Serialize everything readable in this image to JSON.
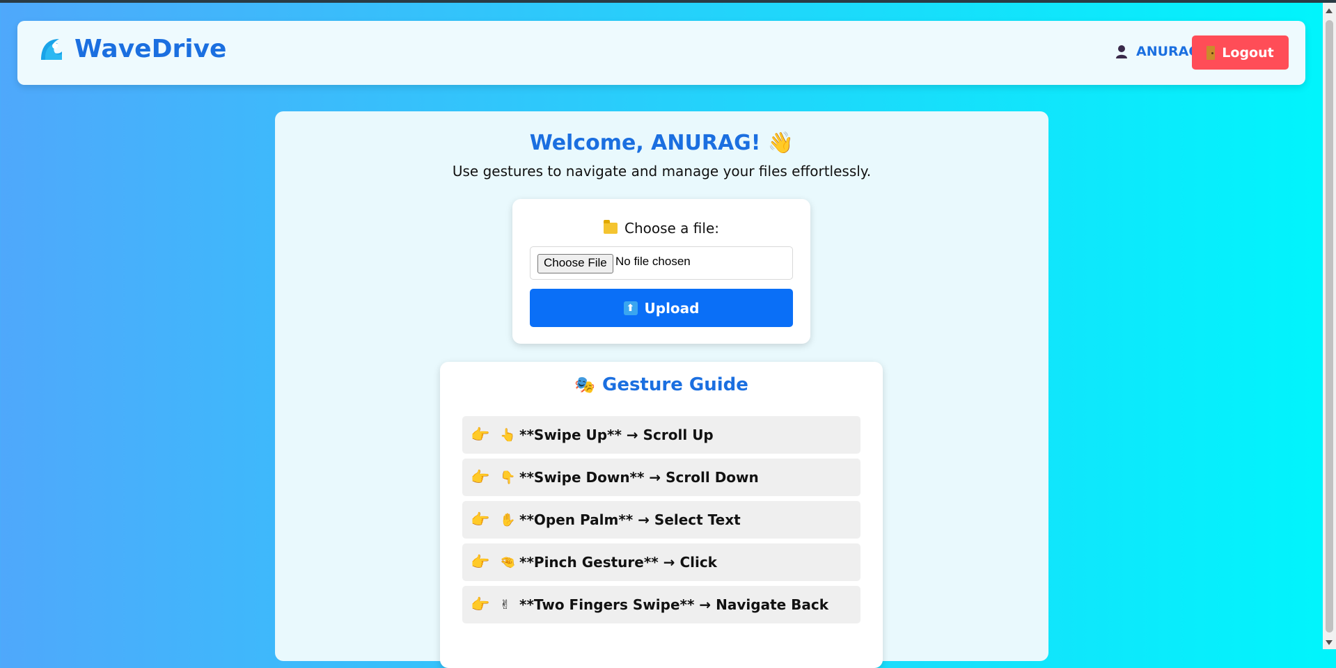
{
  "app": {
    "name": "WaveDrive"
  },
  "header": {
    "username": "ANURAG",
    "logout_label": "Logout"
  },
  "main": {
    "welcome": "Welcome, ANURAG! 👋",
    "subtitle": "Use gestures to navigate and manage your files effortlessly."
  },
  "upload": {
    "label": "Choose a file:",
    "file_button": "Choose File",
    "file_status": "No file chosen",
    "upload_label": "Upload"
  },
  "guide": {
    "title": "Gesture Guide",
    "items": [
      {
        "pointer": "👉",
        "gesture_icon": "👆",
        "text": "**Swipe Up** → Scroll Up"
      },
      {
        "pointer": "👉",
        "gesture_icon": "👇",
        "text": "**Swipe Down** → Scroll Down"
      },
      {
        "pointer": "👉",
        "gesture_icon": "✋",
        "text": "**Open Palm** → Select Text"
      },
      {
        "pointer": "👉",
        "gesture_icon": "🤏",
        "text": "**Pinch Gesture** → Click"
      },
      {
        "pointer": "👉",
        "gesture_icon": "✌",
        "text": "**Two Fingers Swipe** → Navigate Back"
      }
    ]
  },
  "colors": {
    "brand": "#1b6fe0",
    "logout": "#ff4d57",
    "upload": "#0a6ff7"
  }
}
